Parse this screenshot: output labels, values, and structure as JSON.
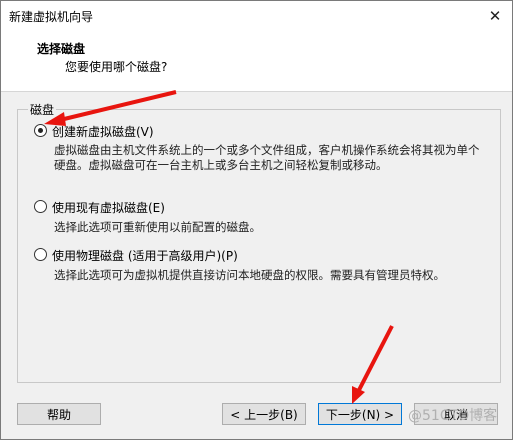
{
  "window": {
    "title": "新建虚拟机向导",
    "close_glyph": "✕"
  },
  "header": {
    "title": "选择磁盘",
    "subtitle": "您要使用哪个磁盘?"
  },
  "group": {
    "label": "磁盘"
  },
  "options": [
    {
      "label": "创建新虚拟磁盘(V)",
      "selected": true,
      "desc": "虚拟磁盘由主机文件系统上的一个或多个文件组成，客户机操作系统会将其视为单个硬盘。虚拟磁盘可在一台主机上或多台主机之间轻松复制或移动。"
    },
    {
      "label": "使用现有虚拟磁盘(E)",
      "selected": false,
      "desc": "选择此选项可重新使用以前配置的磁盘。"
    },
    {
      "label": "使用物理磁盘 (适用于高级用户)(P)",
      "selected": false,
      "desc": "选择此选项可为虚拟机提供直接访问本地硬盘的权限。需要具有管理员特权。"
    }
  ],
  "buttons": {
    "help": "帮助",
    "back": "< 上一步(B)",
    "next": "下一步(N) >",
    "cancel": "取消"
  },
  "watermark": "@51CTO博客",
  "annotation_color": "#e8150f"
}
